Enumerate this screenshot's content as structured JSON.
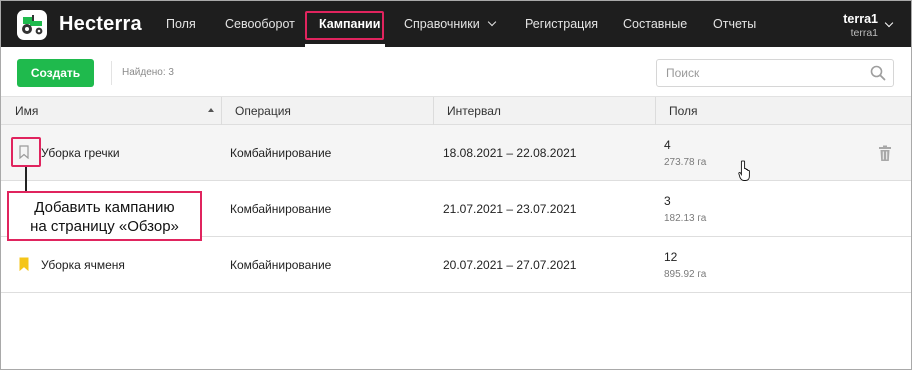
{
  "app": {
    "brand": "Hecterra"
  },
  "nav": {
    "items": [
      {
        "label": "Поля"
      },
      {
        "label": "Севооборот"
      },
      {
        "label": "Кампании"
      },
      {
        "label": "Справочники"
      },
      {
        "label": "Регистрация"
      },
      {
        "label": "Составные"
      },
      {
        "label": "Отчеты"
      }
    ]
  },
  "user": {
    "name": "terra1",
    "account": "terra1"
  },
  "toolbar": {
    "create_label": "Создать",
    "found_text": "Найдено: 3",
    "search_placeholder": "Поиск"
  },
  "table": {
    "columns": [
      "Имя",
      "Операция",
      "Интервал",
      "Поля"
    ],
    "rows": [
      {
        "name": "Уборка гречки",
        "operation": "Комбайнирование",
        "interval": "18.08.2021 – 22.08.2021",
        "fields_count": "4",
        "fields_area": "273.78 га",
        "bookmarked": false
      },
      {
        "name": "",
        "operation": "Комбайнирование",
        "interval": "21.07.2021 – 23.07.2021",
        "fields_count": "3",
        "fields_area": "182.13 га",
        "bookmarked": false
      },
      {
        "name": "Уборка ячменя",
        "operation": "Комбайнирование",
        "interval": "20.07.2021 – 27.07.2021",
        "fields_count": "12",
        "fields_area": "895.92 га",
        "bookmarked": true
      }
    ]
  },
  "callout": {
    "line1": "Добавить кампанию",
    "line2": "на страницу «Обзор»"
  },
  "colors": {
    "header_bg": "#1e1e1e",
    "accent_green": "#1fba4d",
    "highlight_pink": "#e0245e",
    "bookmark_yellow": "#f5c518"
  }
}
